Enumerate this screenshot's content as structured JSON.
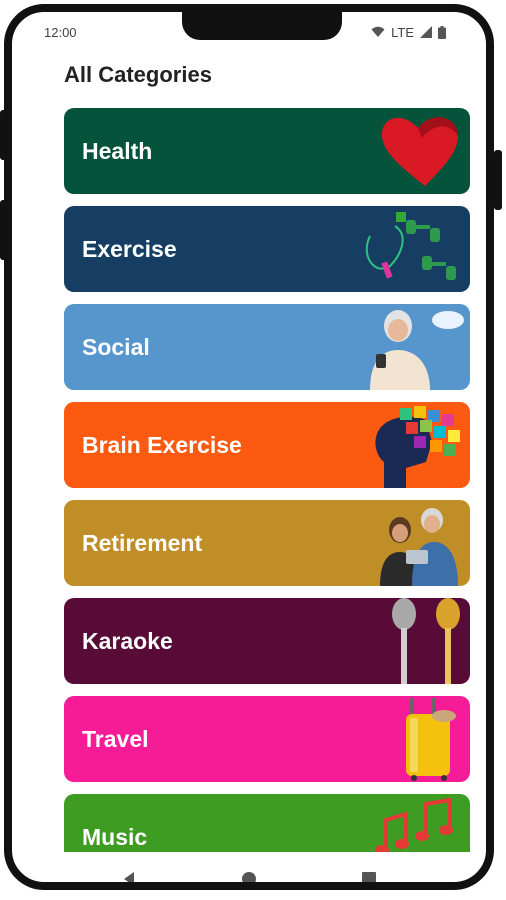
{
  "status": {
    "time": "12:00",
    "network": "LTE"
  },
  "page": {
    "title": "All Categories"
  },
  "categories": [
    {
      "label": "Health",
      "color": "#05533a",
      "icon": "heart-icon"
    },
    {
      "label": "Exercise",
      "color": "#153e62",
      "icon": "dumbbell-icon"
    },
    {
      "label": "Social",
      "color": "#5796cc",
      "icon": "people-icon"
    },
    {
      "label": "Brain Exercise",
      "color": "#fc5a11",
      "icon": "brain-puzzle-icon"
    },
    {
      "label": "Retirement",
      "color": "#bf8e26",
      "icon": "couple-icon"
    },
    {
      "label": "Karaoke",
      "color": "#570b36",
      "icon": "microphone-icon"
    },
    {
      "label": "Travel",
      "color": "#f61c97",
      "icon": "suitcase-icon"
    },
    {
      "label": "Music",
      "color": "#3f9c23",
      "icon": "music-note-icon"
    }
  ],
  "nav": {
    "back": "back-icon",
    "home": "home-icon",
    "recents": "recents-icon"
  }
}
